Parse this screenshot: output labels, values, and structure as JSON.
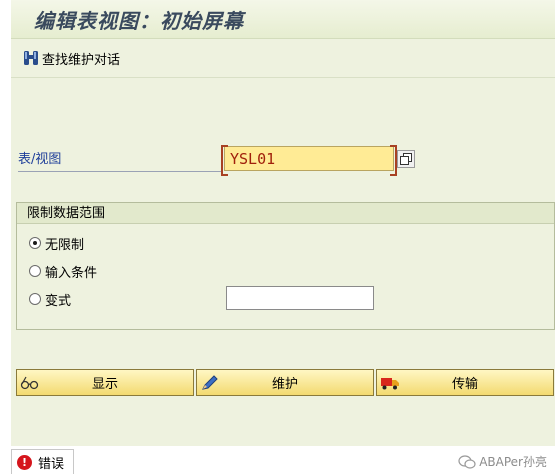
{
  "window": {
    "title": "编辑表视图：初始屏幕"
  },
  "toolbar": {
    "find_dialog_label": "查找维护对话"
  },
  "form": {
    "table_view_label": "表/视图",
    "table_view_value": "YSL01"
  },
  "restrict_group": {
    "title": "限制数据范围",
    "options": [
      {
        "label": "无限制",
        "selected": true
      },
      {
        "label": "输入条件",
        "selected": false
      },
      {
        "label": "变式",
        "selected": false
      }
    ],
    "variant_value": ""
  },
  "actions": {
    "display_label": "显示",
    "maintain_label": "维护",
    "transport_label": "传输"
  },
  "status": {
    "error_label": "错误",
    "error_icon_glyph": "!"
  },
  "watermark": {
    "text": "ABAPer孙亮"
  }
}
